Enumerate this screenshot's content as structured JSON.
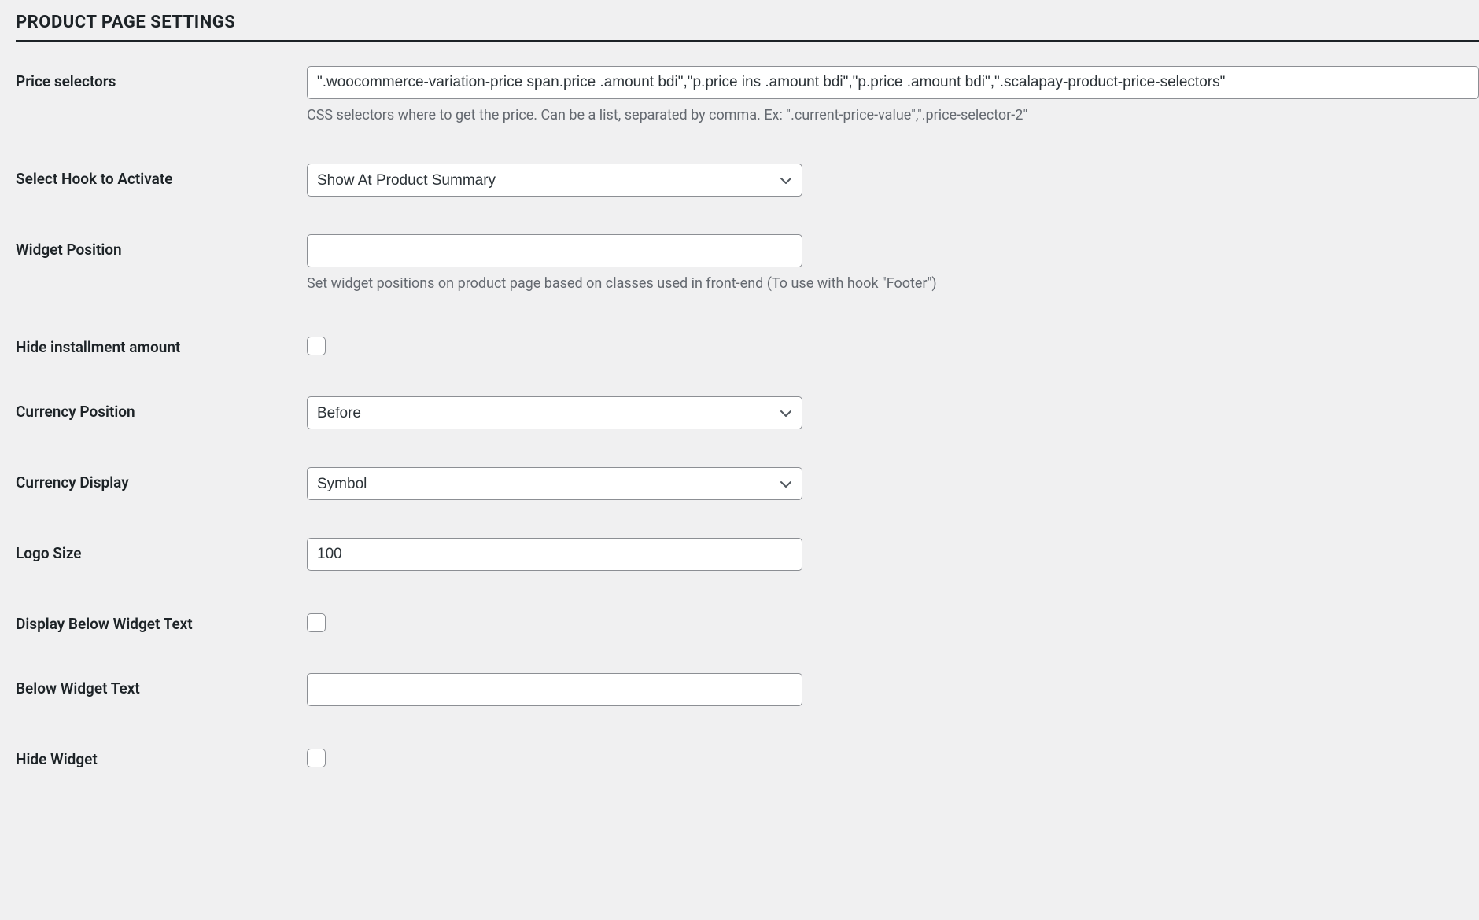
{
  "section_title": "PRODUCT PAGE SETTINGS",
  "fields": {
    "price_selectors": {
      "label": "Price selectors",
      "value": "\".woocommerce-variation-price span.price .amount bdi\",\"p.price ins .amount bdi\",\"p.price .amount bdi\",\".scalapay-product-price-selectors\"",
      "help": "CSS selectors where to get the price. Can be a list, separated by comma. Ex: \".current-price-value\",\".price-selector-2\""
    },
    "select_hook": {
      "label": "Select Hook to Activate",
      "selected": "Show At Product Summary"
    },
    "widget_position": {
      "label": "Widget Position",
      "value": "",
      "help": "Set widget positions on product page based on classes used in front-end (To use with hook \"Footer\")"
    },
    "hide_installment": {
      "label": "Hide installment amount",
      "checked": false
    },
    "currency_position": {
      "label": "Currency Position",
      "selected": "Before"
    },
    "currency_display": {
      "label": "Currency Display",
      "selected": "Symbol"
    },
    "logo_size": {
      "label": "Logo Size",
      "value": "100"
    },
    "display_below_widget_text": {
      "label": "Display Below Widget Text",
      "checked": false
    },
    "below_widget_text": {
      "label": "Below Widget Text",
      "value": ""
    },
    "hide_widget": {
      "label": "Hide Widget",
      "checked": false
    }
  }
}
